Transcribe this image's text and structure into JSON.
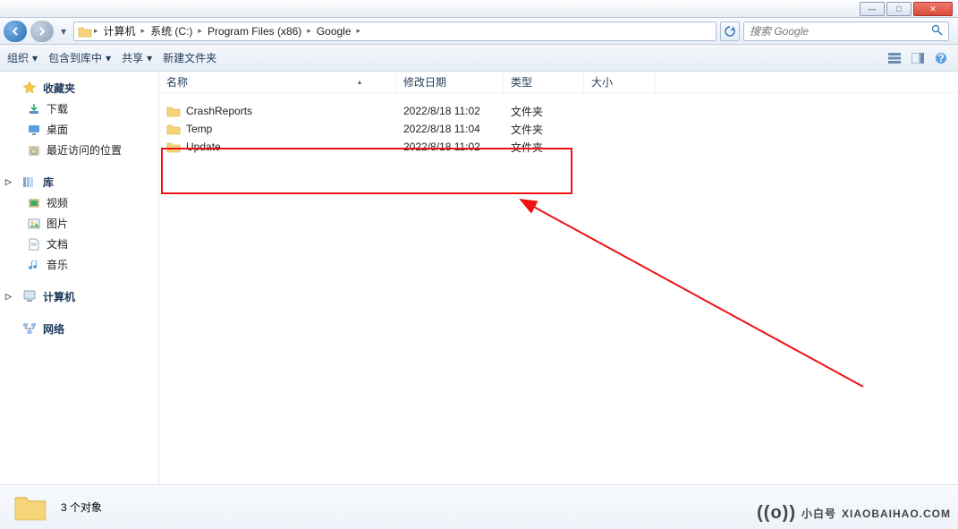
{
  "breadcrumbs": [
    "计算机",
    "系统 (C:)",
    "Program Files (x86)",
    "Google"
  ],
  "search": {
    "placeholder": "搜索 Google"
  },
  "toolbar": {
    "organize": "组织",
    "include": "包含到库中",
    "share": "共享",
    "newfolder": "新建文件夹"
  },
  "columns": {
    "name": "名称",
    "date": "修改日期",
    "type": "类型",
    "size": "大小"
  },
  "rows": [
    {
      "name": "CrashReports",
      "date": "2022/8/18 11:02",
      "type": "文件夹"
    },
    {
      "name": "Temp",
      "date": "2022/8/18 11:04",
      "type": "文件夹"
    },
    {
      "name": "Update",
      "date": "2022/8/18 11:02",
      "type": "文件夹"
    }
  ],
  "sidebar": {
    "fav": {
      "head": "收藏夹",
      "items": [
        "下载",
        "桌面",
        "最近访问的位置"
      ]
    },
    "lib": {
      "head": "库",
      "items": [
        "视频",
        "图片",
        "文档",
        "音乐"
      ]
    },
    "comp": {
      "head": "计算机"
    },
    "net": {
      "head": "网络"
    }
  },
  "status": {
    "count": "3 个对象"
  },
  "watermark": {
    "brand": "小白号",
    "domain": "XIAOBAIHAO.COM"
  }
}
